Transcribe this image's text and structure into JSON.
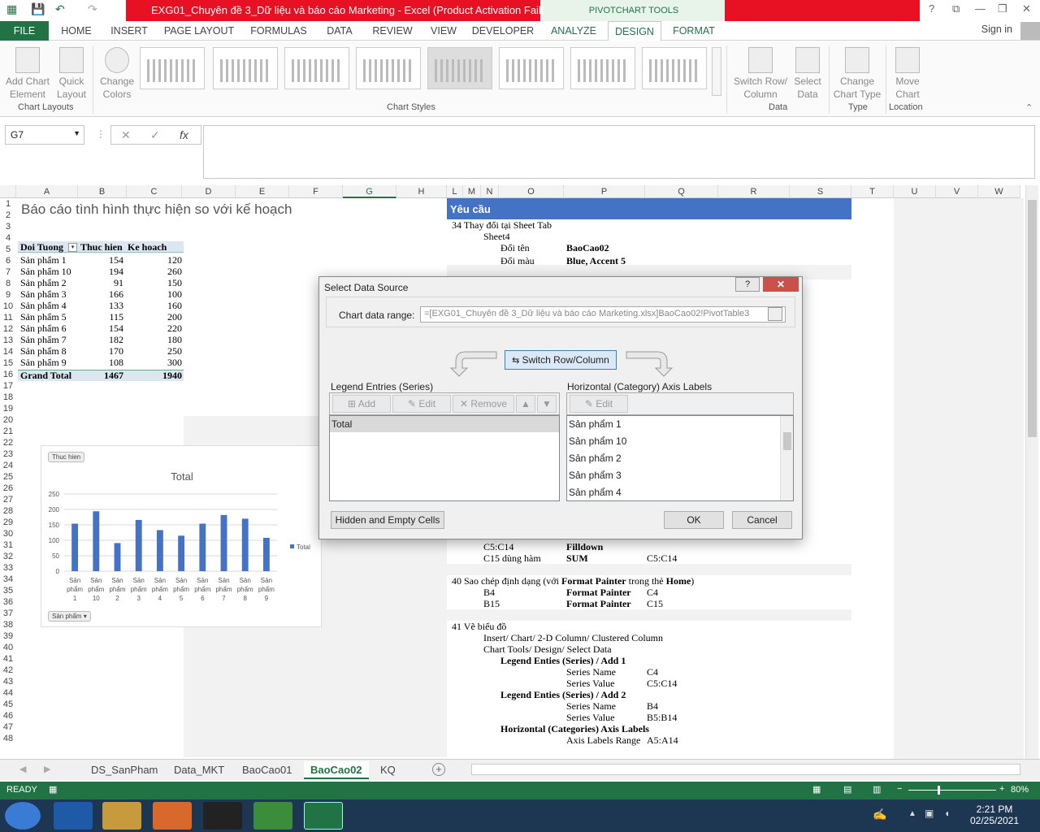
{
  "window": {
    "title": "EXG01_Chuyên đề 3_Dữ liệu và báo cáo Marketing -  Excel (Product Activation Failed)",
    "context_tab": "PIVOTCHART TOOLS",
    "controls": [
      "?",
      "⧉",
      "—",
      "❐",
      "✕"
    ]
  },
  "ribbon_tabs": [
    "FILE",
    "HOME",
    "INSERT",
    "PAGE LAYOUT",
    "FORMULAS",
    "DATA",
    "REVIEW",
    "VIEW",
    "DEVELOPER",
    "ANALYZE",
    "DESIGN",
    "FORMAT"
  ],
  "signin": "Sign in",
  "ribbon": {
    "add_chart_element": "Add Chart Element",
    "quick_layout": "Quick Layout",
    "change_colors": "Change Colors",
    "group_chart_layouts": "Chart Layouts",
    "group_chart_styles": "Chart Styles",
    "switch_row_column": "Switch Row/ Column",
    "select_data": "Select Data",
    "group_data": "Data",
    "change_chart_type": "Change Chart Type",
    "group_type": "Type",
    "move_chart": "Move Chart",
    "group_location": "Location"
  },
  "formula_bar": {
    "name_box": "G7",
    "fx": "fx"
  },
  "columns": [
    "A",
    "B",
    "C",
    "D",
    "E",
    "F",
    "G",
    "H",
    "L",
    "M",
    "N",
    "O",
    "P",
    "Q",
    "R",
    "S",
    "T",
    "U",
    "V",
    "W"
  ],
  "sheet": {
    "title": "Báo cáo tình hình thực hiện so với kế hoạch",
    "headers": [
      "Doi Tuong",
      "Thuc hien",
      "Ke hoach"
    ],
    "rows": [
      [
        "Sản phẩm 1",
        "154",
        "120"
      ],
      [
        "Sản phẩm 10",
        "194",
        "260"
      ],
      [
        "Sản phẩm 2",
        "91",
        "150"
      ],
      [
        "Sản phẩm 3",
        "166",
        "100"
      ],
      [
        "Sản phẩm 4",
        "133",
        "160"
      ],
      [
        "Sản phẩm 5",
        "115",
        "200"
      ],
      [
        "Sản phẩm 6",
        "154",
        "220"
      ],
      [
        "Sản phẩm 7",
        "182",
        "180"
      ],
      [
        "Sản phẩm 8",
        "170",
        "250"
      ],
      [
        "Sản phẩm 9",
        "108",
        "300"
      ]
    ],
    "total": [
      "Grand Total",
      "1467",
      "1940"
    ]
  },
  "panel": {
    "header": "Yêu cầu",
    "s34": "34  Thay đổi tại Sheet Tab",
    "s34_sheet": "Sheet4",
    "s34_rename": "Đổi tên",
    "s34_rename_v": "BaoCao02",
    "s34_color": "Đổi màu",
    "s34_color_v": "Blue, Accent 5",
    "r_c5c14": "C5:C14",
    "r_filldown": "Filldown",
    "r_c15": "C15 dùng hàm",
    "r_sum": "SUM",
    "r_c5c14b": "C5:C14",
    "s40": "40  Sao chép định dạng (với ",
    "s40_b": "Format Painter",
    "s40_c": " trong thẻ ",
    "s40_d": "Home",
    "s40_e": ")",
    "s40_b4": "B4",
    "s40_fp1": "Format Painter",
    "s40_c4": "C4",
    "s40_b15": "B15",
    "s40_fp2": "Format Painter",
    "s40_c15": "C15",
    "s41": "41  Vẽ biểu đồ",
    "s41_a": "Insert/ Chart/ 2-D Column/ Clustered Column",
    "s41_b": "Chart Tools/ Design/ Select Data",
    "s41_c": "Legend Enties (Series) / Add 1",
    "s41_d": "Series Name",
    "s41_d2": "C4",
    "s41_e": "Series Value",
    "s41_e2": "C5:C14",
    "s41_f": "Legend Enties (Series) / Add 2",
    "s41_g": "Series Name",
    "s41_g2": "B4",
    "s41_h": "Series Value",
    "s41_h2": "B5:B14",
    "s41_i": "Horizontal (Categories) Axis Labels",
    "s41_j": "Axis Labels Range",
    "s41_j2": "A5:A14"
  },
  "chart": {
    "field_values": "Thuc hien",
    "field_axis": "Sản phẩm",
    "legend": "Total"
  },
  "chart_data": {
    "type": "bar",
    "title": "Total",
    "categories": [
      "Sản phẩm 1",
      "Sản phẩm 10",
      "Sản phẩm 2",
      "Sản phẩm 3",
      "Sản phẩm 4",
      "Sản phẩm 5",
      "Sản phẩm 6",
      "Sản phẩm 7",
      "Sản phẩm 8",
      "Sản phẩm 9"
    ],
    "series": [
      {
        "name": "Total",
        "values": [
          154,
          194,
          91,
          166,
          133,
          115,
          154,
          182,
          170,
          108
        ],
        "color": "#4472c4"
      }
    ],
    "ylim": [
      0,
      250
    ],
    "yticks": [
      0,
      50,
      100,
      150,
      200,
      250
    ],
    "legend_position": "right",
    "grid": true
  },
  "dialog": {
    "title": "Select Data Source",
    "range_label": "Chart data range:",
    "range_value": "=[EXG01_Chuyên đề 3_Dữ liệu và báo cáo Marketing.xlsx]BaoCao02!PivotTable3",
    "switch": "Switch Row/Column",
    "legend_label": "Legend Entries (Series)",
    "add": "Add",
    "edit": "Edit",
    "remove": "Remove",
    "series_items": [
      "Total"
    ],
    "axis_label": "Horizontal (Category) Axis Labels",
    "axis_edit": "Edit",
    "axis_items": [
      "Sản phẩm 1",
      "Sản phẩm 10",
      "Sản phẩm 2",
      "Sản phẩm 3",
      "Sản phẩm 4"
    ],
    "hidden": "Hidden and Empty Cells",
    "ok": "OK",
    "cancel": "Cancel"
  },
  "sheet_tabs": [
    "DS_SanPham",
    "Data_MKT",
    "BaoCao01",
    "BaoCao02",
    "KQ"
  ],
  "status": {
    "ready": "READY",
    "zoom": "80%"
  },
  "clock": {
    "time": "2:21 PM",
    "date": "02/25/2021"
  }
}
